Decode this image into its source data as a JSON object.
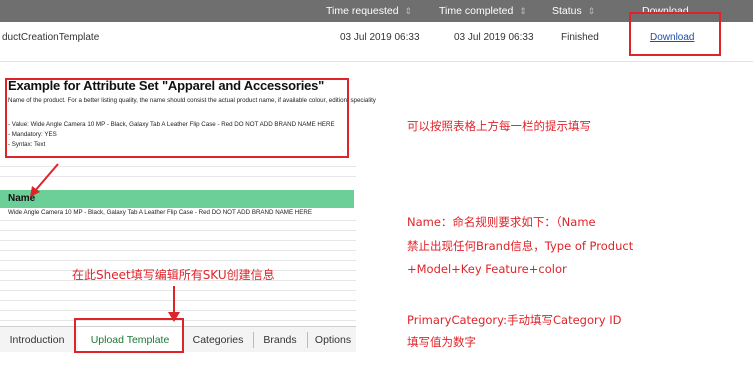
{
  "table": {
    "headers": [
      {
        "label": "Time requested"
      },
      {
        "label": "Time completed"
      },
      {
        "label": "Status"
      },
      {
        "label": "Download"
      }
    ],
    "row": {
      "name": "ductCreationTemplate",
      "time_requested": "03 Jul 2019 06:33",
      "time_completed": "03 Jul 2019 06:33",
      "status": "Finished",
      "download": "Download"
    }
  },
  "sheet": {
    "example_title": "Example for Attribute Set \"Apparel and Accessories\"",
    "example_lines": [
      "Name of the product. For a better listing quality, the name should consist the actual product name, if available colour, edition, speciality",
      "- Value: Wide Angle Camera 10 MP - Black, Galaxy Tab A Leather Flip Case - Red DO NOT ADD BRAND NAME HERE",
      "- Mandatory: YES",
      "- Syntax: Text"
    ],
    "column_name": "Name",
    "name_value": "Wide Angle Camera 10 MP - Black, Galaxy Tab A Leather Flip Case - Red DO NOT ADD BRAND NAME HERE"
  },
  "tabs": [
    {
      "label": "Introduction"
    },
    {
      "label": "Upload Template"
    },
    {
      "label": "Categories"
    },
    {
      "label": "Brands"
    },
    {
      "label": "Options"
    }
  ],
  "annotations": {
    "hint": "可以按照表格上方每一栏的提示填写",
    "sheet_note": "在此Sheet填写编辑所有SKU创建信息",
    "name_rule_1": "Name：命名规则要求如下：（Name",
    "name_rule_2": "禁止出现任何Brand信息，Type of Product",
    "name_rule_3": "+Model+Key Feature+color",
    "category_1": "PrimaryCategory:手动填写Category ID",
    "category_2": "填写值为数字"
  },
  "colors": {
    "header_bg": "#6f6f6f",
    "highlight_red": "#e0232a",
    "name_green": "#6ccf97",
    "link_blue": "#1e4fa3"
  }
}
